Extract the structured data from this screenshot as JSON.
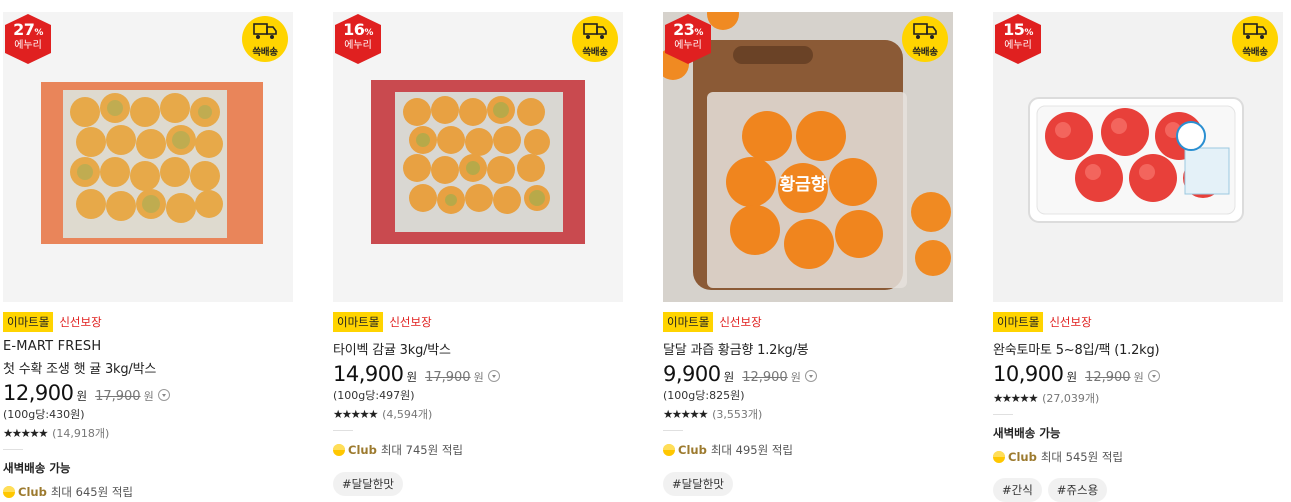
{
  "colors": {
    "discount_red": "#e02020",
    "ssg_yellow": "#ffd400",
    "mall_tag_yellow": "#ffd400",
    "fresh_red": "#e0201f",
    "club_gold": "#9c7a2e"
  },
  "products": [
    {
      "discount_pct": "27",
      "pct_sign": "%",
      "discount_label": "에누리",
      "ssg_label": "쓱배송",
      "mall_tag": "이마트몰",
      "fresh_tag": "신선보장",
      "brand": "E-MART FRESH",
      "name": "첫 수확 조생 햇 귤 3kg/박스",
      "price": "12,900",
      "won": "원",
      "original_price": "17,900",
      "unit_price": "(100g당:430원)",
      "stars": "★★★★★",
      "review_count": "(14,918개)",
      "dawn_delivery": "새벽배송 가능",
      "club_name": "Club",
      "club_text": "최대 645원 적립",
      "hashtags": []
    },
    {
      "discount_pct": "16",
      "pct_sign": "%",
      "discount_label": "에누리",
      "ssg_label": "쓱배송",
      "mall_tag": "이마트몰",
      "fresh_tag": "신선보장",
      "brand": "",
      "name": "타이벡 감귤 3kg/박스",
      "price": "14,900",
      "won": "원",
      "original_price": "17,900",
      "unit_price": "(100g당:497원)",
      "stars": "★★★★★",
      "review_count": "(4,594개)",
      "dawn_delivery": "",
      "club_name": "Club",
      "club_text": "최대 745원 적립",
      "hashtags": [
        "#달달한맛"
      ]
    },
    {
      "discount_pct": "23",
      "pct_sign": "%",
      "discount_label": "에누리",
      "ssg_label": "쓱배송",
      "mall_tag": "이마트몰",
      "fresh_tag": "신선보장",
      "brand": "",
      "name": "달달 과즙 황금향 1.2kg/봉",
      "price": "9,900",
      "won": "원",
      "original_price": "12,900",
      "unit_price": "(100g당:825원)",
      "stars": "★★★★★",
      "review_count": "(3,553개)",
      "dawn_delivery": "",
      "club_name": "Club",
      "club_text": "최대 495원 적립",
      "hashtags": [
        "#달달한맛"
      ],
      "bag_label": "황금향"
    },
    {
      "discount_pct": "15",
      "pct_sign": "%",
      "discount_label": "에누리",
      "ssg_label": "쓱배송",
      "mall_tag": "이마트몰",
      "fresh_tag": "신선보장",
      "brand": "",
      "name": "완숙토마토 5~8입/팩 (1.2kg)",
      "price": "10,900",
      "won": "원",
      "original_price": "12,900",
      "unit_price": "",
      "stars": "★★★★★",
      "review_count": "(27,039개)",
      "dawn_delivery": "새벽배송 가능",
      "club_name": "Club",
      "club_text": "최대 545원 적립",
      "hashtags": [
        "#간식",
        "#쥬스용"
      ]
    }
  ]
}
